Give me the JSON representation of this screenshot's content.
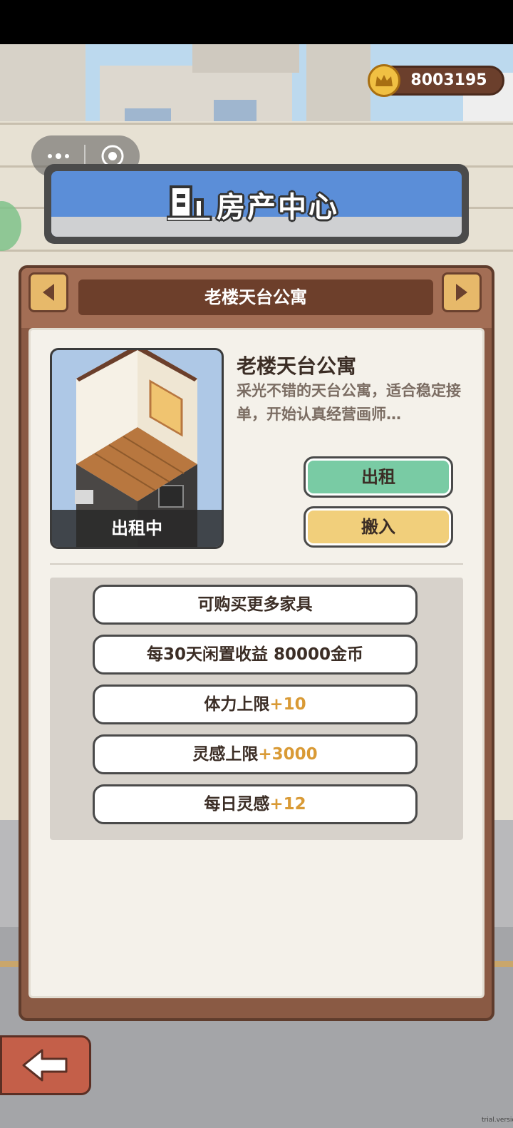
{
  "coins": {
    "value": "8003195"
  },
  "title_banner": {
    "text": "房产中心"
  },
  "property_selector": {
    "name": "老楼天台公寓"
  },
  "property": {
    "title": "老楼天台公寓",
    "description": "采光不错的天台公寓，适合稳定接单，开始认真经营画师…",
    "status": "出租中"
  },
  "actions": {
    "rent_label": "出租",
    "move_in_label": "搬入"
  },
  "perks": [
    {
      "text": "可购买更多家具",
      "bonus": ""
    },
    {
      "text": "每30天闲置收益 80000金币",
      "bonus": ""
    },
    {
      "text": "体力上限",
      "bonus": "+10"
    },
    {
      "text": "灵感上限",
      "bonus": "+3000"
    },
    {
      "text": "每日灵感",
      "bonus": "+12"
    }
  ],
  "watermark": "trial.version",
  "colors": {
    "accent_green": "#79cba4",
    "accent_yellow": "#f1cf7b",
    "bonus_orange": "#d99a35",
    "panel_brown": "#8a5a44"
  }
}
